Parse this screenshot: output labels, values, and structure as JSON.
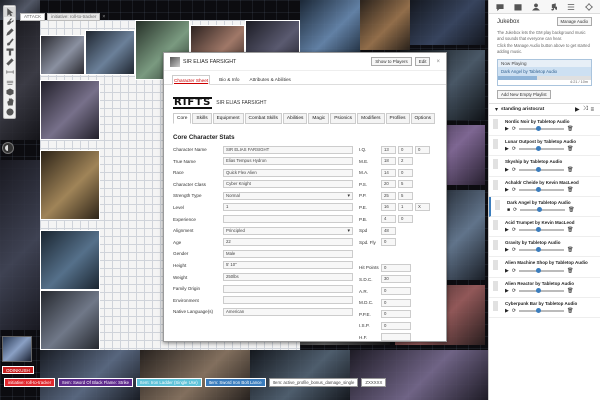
{
  "layers": {
    "attack": "ATTACK",
    "active_label": "initiative: roll-to-tracker"
  },
  "tools": [
    "cursor-icon",
    "wrench-icon",
    "pencil-icon",
    "brush-icon",
    "text-icon",
    "ruler-icon",
    "measure-icon",
    "fog-icon",
    "dice-icon",
    "hand-icon",
    "help-icon"
  ],
  "player": {
    "name": "ODINKUSH"
  },
  "macros": [
    {
      "label": "initiative: roll-to-tracker",
      "style": "m-red"
    },
    {
      "label": "Item: Sword Of Black Flame: Strike",
      "style": "m-purple"
    },
    {
      "label": "Item: Iron Ladder (Single Use)",
      "style": "m-teal"
    },
    {
      "label": "Item: Sword Iron Bolt Lance",
      "style": "m-blue"
    },
    {
      "label": "Item: active_profile_bonus_damage_single",
      "style": "m-white"
    },
    {
      "label": "ZXXXXX",
      "style": "m-white"
    }
  ],
  "dialog": {
    "title": "SIR ELIAS FARSIGHT",
    "show_players": "Show to Players",
    "edit": "Edit",
    "tabs": [
      "Character Sheet",
      "Bio & Info",
      "Attributes & Abilities"
    ],
    "logo": "RIFTS",
    "char_name": "SIR ELIAS FARSIGHT",
    "sheet_tabs": [
      "Core",
      "Skills",
      "Equipment",
      "Combat Skills",
      "Abilities",
      "Magic",
      "Psionics",
      "Modifiers",
      "Profiles",
      "Options"
    ],
    "section": "Core Character Stats",
    "fields": [
      {
        "label": "Character Name",
        "value": "SIR ELIAS FARSIGHT",
        "select": false
      },
      {
        "label": "True Name",
        "value": "Elias Tempus Hydron",
        "select": false
      },
      {
        "label": "Race",
        "value": "Quick Flex Alien",
        "select": false
      },
      {
        "label": "Character Class",
        "value": "Cyber Knight",
        "select": false
      },
      {
        "label": "Strength Type",
        "value": "Normal",
        "select": true
      },
      {
        "label": "Level",
        "value": "1",
        "select": false
      },
      {
        "label": "Experience",
        "value": "",
        "select": false
      },
      {
        "label": "Alignment",
        "value": "Principled",
        "select": true
      },
      {
        "label": "Age",
        "value": "22",
        "select": false
      },
      {
        "label": "Gender",
        "value": "Male",
        "select": false
      },
      {
        "label": "Height",
        "value": "5' 10\"",
        "select": false
      },
      {
        "label": "Weight",
        "value": "250lbs",
        "select": false
      },
      {
        "label": "Family Origin",
        "value": "",
        "select": false
      },
      {
        "label": "Environment",
        "value": "",
        "select": false
      },
      {
        "label": "Native Language(s)",
        "value": "American",
        "select": false
      }
    ],
    "attributes": [
      {
        "label": "I.Q.",
        "values": [
          "13",
          "0",
          "0"
        ]
      },
      {
        "label": "M.E.",
        "values": [
          "18",
          "2",
          ""
        ]
      },
      {
        "label": "M.A.",
        "values": [
          "14",
          "0",
          ""
        ]
      },
      {
        "label": "P.S.",
        "values": [
          "20",
          "5",
          ""
        ]
      },
      {
        "label": "P.P.",
        "values": [
          "25",
          "5",
          ""
        ]
      },
      {
        "label": "P.E.",
        "values": [
          "16",
          "1",
          "X"
        ]
      },
      {
        "label": "P.B.",
        "values": [
          "4",
          "0",
          ""
        ]
      },
      {
        "label": "Spd",
        "values": [
          "48",
          "",
          ""
        ]
      },
      {
        "label": "Spd. Fly",
        "values": [
          "0",
          "",
          ""
        ]
      }
    ],
    "combat": [
      {
        "label": "Hit Points",
        "value": "0"
      },
      {
        "label": "S.D.C.",
        "value": "30"
      },
      {
        "label": "A.R.",
        "value": "0"
      },
      {
        "label": "M.D.C.",
        "value": "0"
      },
      {
        "label": "P.P.E.",
        "value": "0"
      },
      {
        "label": "I.S.P.",
        "value": "0"
      },
      {
        "label": "H.F.",
        "value": ""
      }
    ]
  },
  "sidebar": {
    "tabs": [
      "chat-icon",
      "book-icon",
      "user-icon",
      "music-icon",
      "list-icon",
      "gear-icon"
    ],
    "jukebox_title": "Jukebox",
    "manage": "Manage Audio",
    "desc1": "The Jukebox lets the GM play background music and sounds that everyone can hear.",
    "desc2": "Click the Manage Audio button above to get started adding music.",
    "now_playing": "Now Playing",
    "current": "Dark Angel by Tabletop Audio",
    "time": "4:21 / 10m",
    "progress": 0.42,
    "add_playlist": "Add New Empty Playlist",
    "playlist": "standing aristocrat",
    "tracks": [
      {
        "name": "Nordic Noir by Tabletop Audio",
        "playing": false
      },
      {
        "name": "Lunar Outpost by Tabletop Audio",
        "playing": false
      },
      {
        "name": "Skyship by Tabletop Audio",
        "playing": false
      },
      {
        "name": "Achaldr Cheide by Kevin MacLeod",
        "playing": false
      },
      {
        "name": "Dark Angel by Tabletop Audio",
        "playing": true
      },
      {
        "name": "Acid Trumpet by Kevin MacLeod",
        "playing": false
      },
      {
        "name": "Gravity by Tabletop Audio",
        "playing": false
      },
      {
        "name": "Alien Machine Shop by Tabletop Audio",
        "playing": false
      },
      {
        "name": "Alien Reactor by Tabletop Audio",
        "playing": false
      },
      {
        "name": "Cyberpunk Bar by Tabletop Audio",
        "playing": false
      }
    ]
  }
}
